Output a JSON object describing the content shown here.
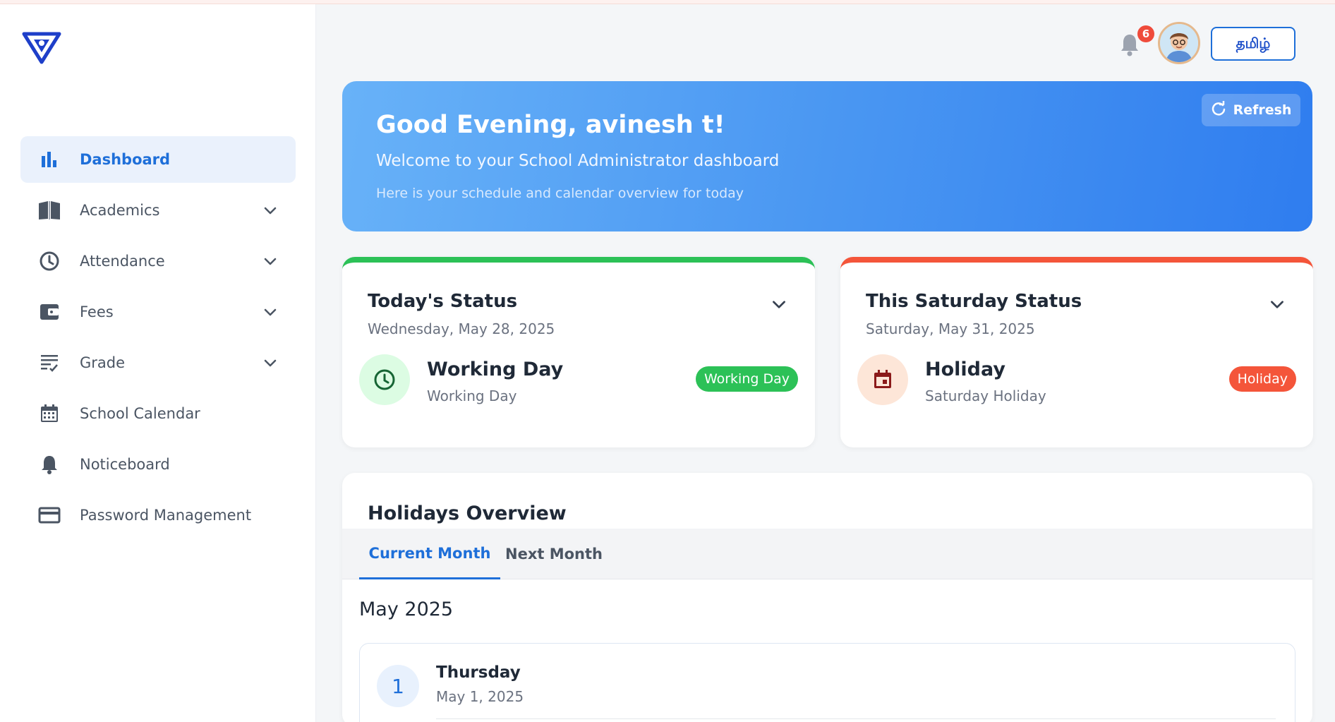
{
  "header": {
    "notification_count": "6",
    "language_button": "தமிழ்"
  },
  "sidebar": {
    "items": [
      {
        "label": "Dashboard",
        "icon": "bar-chart-icon",
        "active": true
      },
      {
        "label": "Academics",
        "icon": "book-icon",
        "expandable": true
      },
      {
        "label": "Attendance",
        "icon": "clock-icon",
        "expandable": true
      },
      {
        "label": "Fees",
        "icon": "wallet-icon",
        "expandable": true
      },
      {
        "label": "Grade",
        "icon": "list-check-icon",
        "expandable": true
      },
      {
        "label": "School Calendar",
        "icon": "calendar-icon"
      },
      {
        "label": "Noticeboard",
        "icon": "bell-icon"
      },
      {
        "label": "Password Management",
        "icon": "card-icon"
      }
    ]
  },
  "banner": {
    "greeting": "Good Evening, avinesh t!",
    "subtitle": "Welcome to your School Administrator dashboard",
    "note": "Here is your schedule and calendar overview for today",
    "refresh_label": "Refresh"
  },
  "today": {
    "title": "Today's Status",
    "date": "Wednesday, May 28, 2025",
    "status": "Working Day",
    "detail": "Working Day",
    "badge": "Working Day",
    "accent": "#2cc157"
  },
  "saturday": {
    "title": "This Saturday Status",
    "date": "Saturday, May 31, 2025",
    "status": "Holiday",
    "detail": "Saturday Holiday",
    "badge": "Holiday",
    "accent": "#f4553a"
  },
  "holidays": {
    "title": "Holidays Overview",
    "tabs": [
      {
        "label": "Current Month",
        "active": true
      },
      {
        "label": "Next Month",
        "active": false
      }
    ],
    "month": "May 2025",
    "items": [
      {
        "day": "1",
        "weekday": "Thursday",
        "date": "May 1, 2025"
      }
    ]
  },
  "colors": {
    "primary": "#1e6fd9",
    "working": "#2cc157",
    "holiday": "#f4553a"
  }
}
